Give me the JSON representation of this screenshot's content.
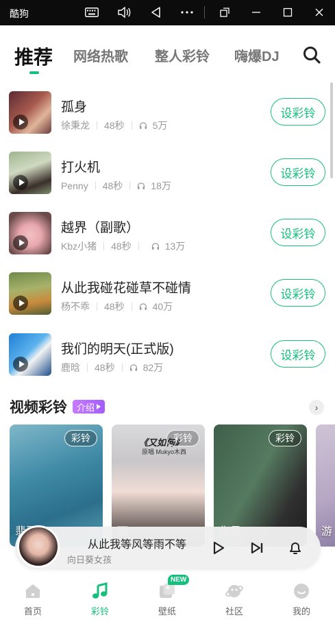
{
  "window": {
    "app_name": "酷狗",
    "buttons": [
      "keyboard-icon",
      "volume-icon",
      "back-icon",
      "more-icon",
      "rotate-icon",
      "minimize-icon",
      "maximize-icon",
      "close-icon"
    ]
  },
  "tabs": [
    {
      "label": "推荐",
      "active": true
    },
    {
      "label": "网络热歌",
      "active": false
    },
    {
      "label": "整人彩铃",
      "active": false
    },
    {
      "label": "嗨爆DJ",
      "active": false
    }
  ],
  "songs": [
    {
      "title": "孤身",
      "artist": "徐秉龙",
      "duration": "48秒",
      "plays": "5万",
      "action": "设彩铃"
    },
    {
      "title": "打火机",
      "artist": "Penny",
      "duration": "48秒",
      "plays": "18万",
      "action": "设彩铃"
    },
    {
      "title": "越界（副歌）",
      "artist": "Kbz小猪",
      "duration": "48秒",
      "plays": "13万",
      "action": "设彩铃"
    },
    {
      "title": "从此我碰花碰草不碰情",
      "artist": "杨不乖",
      "duration": "48秒",
      "plays": "40万",
      "action": "设彩铃"
    },
    {
      "title": "我们的明天(正式版)",
      "artist": "鹿晗",
      "duration": "48秒",
      "plays": "82万",
      "action": "设彩铃"
    }
  ],
  "video_section": {
    "title": "视频彩铃",
    "intro_label": "介绍",
    "more_label": "›",
    "cards": [
      {
        "badge": "彩铃",
        "caption": "翡翠"
      },
      {
        "badge": "彩铃",
        "caption": "雨",
        "overlay_text": "《又如何》",
        "overlay_sub": "原唱 Mukyo木西"
      },
      {
        "badge": "彩铃",
        "caption": "你是"
      },
      {
        "badge": "",
        "caption": "游"
      }
    ]
  },
  "player": {
    "title": "从此我等风等雨不等",
    "artist": "向日葵女孩"
  },
  "bottom_nav": [
    {
      "label": "首页",
      "icon": "home-icon",
      "active": false
    },
    {
      "label": "彩铃",
      "icon": "music-note-icon",
      "active": true
    },
    {
      "label": "壁纸",
      "icon": "wallpaper-icon",
      "active": false,
      "badge": "NEW"
    },
    {
      "label": "社区",
      "icon": "planet-icon",
      "active": false
    },
    {
      "label": "我的",
      "icon": "profile-icon",
      "active": false
    }
  ],
  "colors": {
    "accent": "#16c07c",
    "intro_badge": "#b06bff"
  }
}
